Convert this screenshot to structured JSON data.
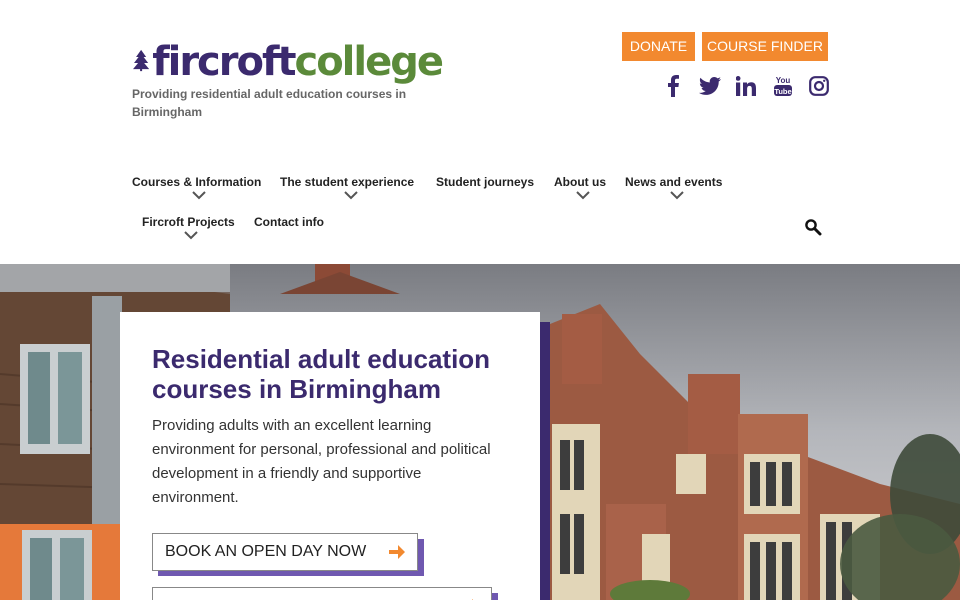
{
  "logo": {
    "word_a": "fircroft",
    "word_b": "college"
  },
  "tagline": "Providing residential adult education courses in Birmingham",
  "top_buttons": {
    "donate": "DONATE",
    "finder": "COURSE FINDER"
  },
  "social": [
    "facebook-icon",
    "twitter-icon",
    "linkedin-icon",
    "youtube-icon",
    "instagram-icon"
  ],
  "nav": {
    "courses": "Courses & Information",
    "student_experience": "The student experience",
    "journeys": "Student journeys",
    "about": "About us",
    "news": "News and events",
    "projects": "Fircroft Projects",
    "contact": "Contact info"
  },
  "hero": {
    "title": "Residential adult education courses in Birmingham",
    "text": "Providing adults with an excellent learning environment for personal, professional and political development in a friendly and supportive environment.",
    "cta_primary": "BOOK AN OPEN DAY NOW",
    "cta_secondary": ""
  },
  "colors": {
    "purple": "#3b2a6e",
    "green": "#5b8a3a",
    "orange": "#f2892f",
    "cta_shadow": "#6f58b0"
  }
}
